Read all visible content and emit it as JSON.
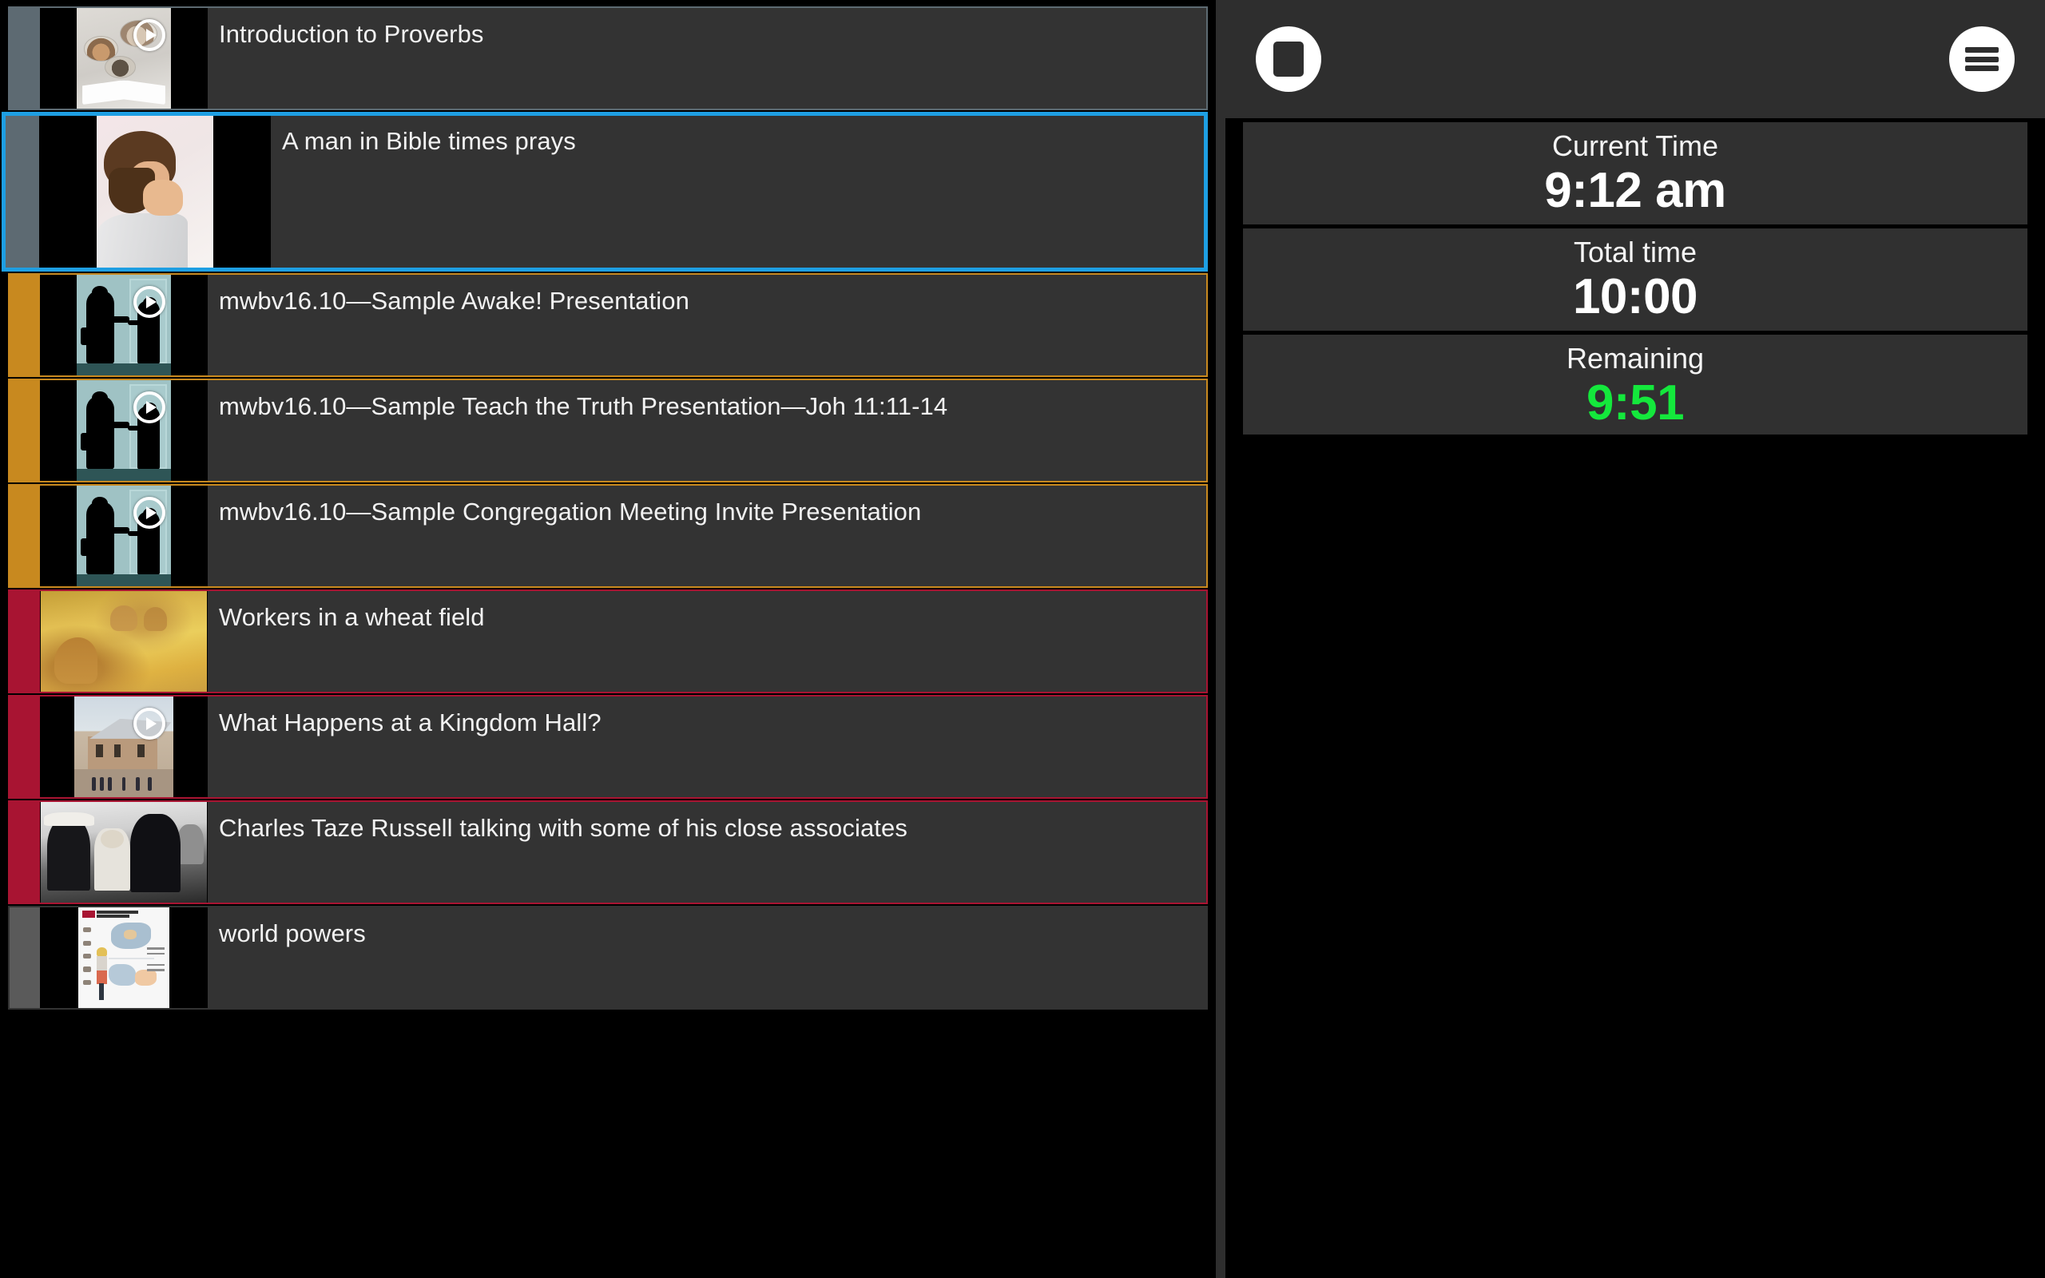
{
  "app": {
    "background": "#000000",
    "panel_bg": "#333333",
    "toolbar_bg": "#2e2e2e",
    "selection_color": "#1e9fe3",
    "accent_slate": "#5d6a72",
    "accent_amber": "#c8891f",
    "accent_crimson": "#a81432",
    "remaining_color": "#14e83c"
  },
  "toolbar": {
    "stop_button_label": "stop",
    "menu_button_label": "menu",
    "stop_icon": "stop-square-icon",
    "menu_icon": "hamburger-menu-icon"
  },
  "timer": {
    "cards": [
      {
        "label": "Current Time",
        "value": "9:12 am",
        "value_color": "#ffffff"
      },
      {
        "label": "Total time",
        "value": "10:00",
        "value_color": "#ffffff"
      },
      {
        "label": "Remaining",
        "value": "9:51",
        "value_color": "#14e83c"
      }
    ]
  },
  "media_list": {
    "items": [
      {
        "title": "Introduction to Proverbs",
        "accent": "slate",
        "border": "slate",
        "selected": false,
        "has_play_badge": true,
        "thumbnail": "open-book-with-portrait-bubbles-thumbnail"
      },
      {
        "title": "A man in Bible times prays",
        "accent": "slate",
        "border": "selected",
        "selected": true,
        "has_play_badge": false,
        "thumbnail": "praying-man-illustration-thumbnail"
      },
      {
        "title": "mwbv16.10—Sample Awake! Presentation",
        "accent": "amber",
        "border": "amber",
        "selected": false,
        "has_play_badge": true,
        "thumbnail": "door-to-door-presentation-silhouette-thumbnail"
      },
      {
        "title": "mwbv16.10—Sample Teach the Truth Presentation—Joh 11:11-14",
        "accent": "amber",
        "border": "amber",
        "selected": false,
        "has_play_badge": true,
        "thumbnail": "door-to-door-presentation-silhouette-thumbnail"
      },
      {
        "title": "mwbv16.10—Sample Congregation Meeting Invite Presentation",
        "accent": "amber",
        "border": "amber",
        "selected": false,
        "has_play_badge": true,
        "thumbnail": "door-to-door-presentation-silhouette-thumbnail"
      },
      {
        "title": "Workers in a wheat field",
        "accent": "crimson",
        "border": "crimson",
        "selected": false,
        "has_play_badge": false,
        "thumbnail": "wheat-field-harvest-painting-thumbnail"
      },
      {
        "title": "What Happens at a Kingdom Hall?",
        "accent": "crimson",
        "border": "crimson",
        "selected": false,
        "has_play_badge": true,
        "thumbnail": "kingdom-hall-building-photo-thumbnail"
      },
      {
        "title": "Charles Taze Russell talking with some of his close associates",
        "accent": "crimson",
        "border": "crimson",
        "selected": false,
        "has_play_badge": false,
        "thumbnail": "black-and-white-historical-crowd-photo-thumbnail"
      },
      {
        "title": "world powers",
        "accent": "grey",
        "border": "none",
        "selected": false,
        "has_play_badge": false,
        "thumbnail": "world-powers-chart-page-thumbnail"
      }
    ]
  }
}
